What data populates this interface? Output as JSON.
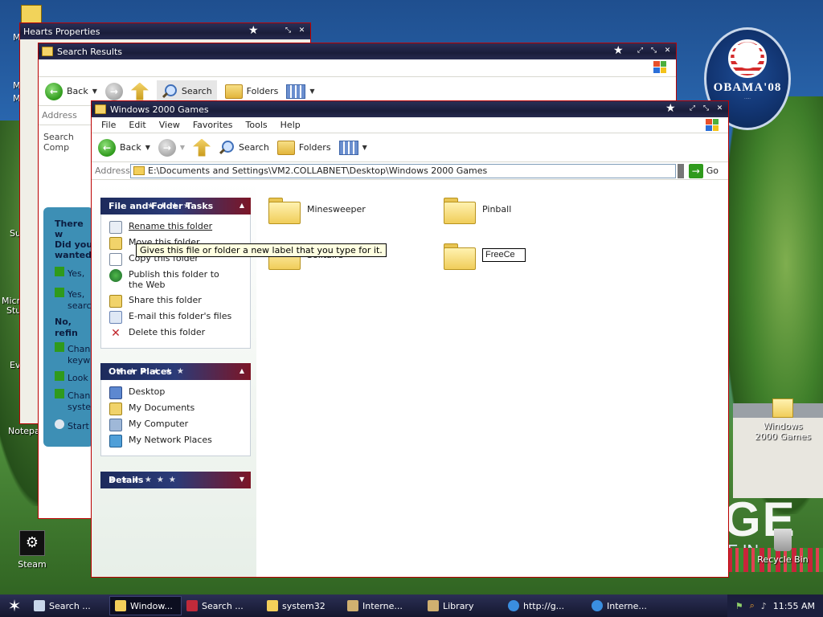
{
  "desktop": {
    "icons": {
      "steam": "Steam",
      "windows2000games": "Windows 2000 Games",
      "recycle_bin": "Recycle Bin",
      "notepad_fragment": "Notepad",
      "micro_fragment": "Micro",
      "stu_fragment": "Stu",
      "ev_fragment": "Ev",
      "su_fragment": "Su",
      "m_fragment": "M",
      "m_fragment2": "M",
      "m_fragment3": "M"
    },
    "badge": {
      "name": "OBAMA",
      "year": "'08"
    },
    "wallpaper_text": {
      "big": "GE",
      "small": "E IN"
    }
  },
  "hearts_window": {
    "title": "Hearts Properties"
  },
  "search_window": {
    "title": "Search Results",
    "toolbar": {
      "back": "Back",
      "search": "Search",
      "folders": "Folders"
    },
    "address_label": "Address",
    "search_comp_fragment": "Search Comp",
    "assistant": {
      "q1": "There w",
      "q2": "Did you",
      "q3": "wanted?",
      "yes1": "Yes,",
      "yes2": "Yes,",
      "yes2b": "searc",
      "refine": "No, refin",
      "ch1": "Chan",
      "ch1b": "keyw",
      "look": "Look",
      "ch2": "Chan",
      "ch2b": "syste",
      "start": "Start"
    }
  },
  "main_window": {
    "title": "Windows 2000 Games",
    "menu": [
      "File",
      "Edit",
      "View",
      "Favorites",
      "Tools",
      "Help"
    ],
    "toolbar": {
      "back": "Back",
      "search": "Search",
      "folders": "Folders"
    },
    "address_label": "Address",
    "address_value": "E:\\Documents and Settings\\VM2.COLLABNET\\Desktop\\Windows 2000 Games",
    "go_label": "Go",
    "file_folder_tasks": {
      "header": "File and Folder Tasks",
      "items": [
        "Rename this folder",
        "Move this folder",
        "Copy this folder",
        "Publish this folder to the Web",
        "Share this folder",
        "E-mail this folder's files",
        "Delete this folder"
      ]
    },
    "other_places": {
      "header": "Other Places",
      "items": [
        "Desktop",
        "My Documents",
        "My Computer",
        "My Network Places"
      ]
    },
    "details": {
      "header": "Details"
    },
    "folders": {
      "minesweeper": "Minesweeper",
      "pinball": "Pinball",
      "solitaire": "Solitaire",
      "freecell_editing": "FreeCe"
    },
    "tooltip": "Gives this file or folder a new label that you type for it."
  },
  "taskbar": {
    "buttons": [
      {
        "label": "Search ...",
        "icon": "search-window-icon"
      },
      {
        "label": "Window...",
        "icon": "folder-icon"
      },
      {
        "label": "Search ...",
        "icon": "search-window-icon"
      },
      {
        "label": "system32",
        "icon": "folder-icon"
      },
      {
        "label": "Interne...",
        "icon": "tool-icon"
      },
      {
        "label": "Library",
        "icon": "tool-icon"
      },
      {
        "label": "http://g...",
        "icon": "ie-icon"
      },
      {
        "label": "Interne...",
        "icon": "ie-icon"
      }
    ],
    "clock": "11:55 AM"
  },
  "colors": {
    "titlebar": "#1a1d3a",
    "panel_header_left": "#1d2b5c",
    "panel_header_right": "#7c1526",
    "tooltip_bg": "#ffffe1"
  }
}
